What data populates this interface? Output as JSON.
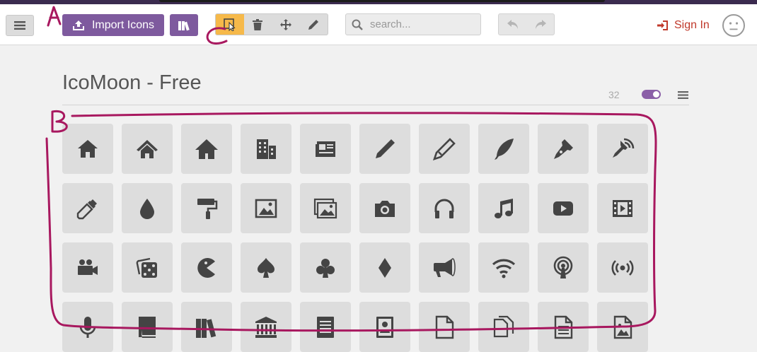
{
  "toolbar": {
    "import_label": "Import Icons",
    "search_placeholder": "search...",
    "sign_in_label": "Sign In"
  },
  "tools": [
    {
      "icon": "select-cursor-icon",
      "active": true
    },
    {
      "icon": "trash-icon",
      "active": false
    },
    {
      "icon": "move-icon",
      "active": false
    },
    {
      "icon": "pencil-edit-icon",
      "active": false
    }
  ],
  "set": {
    "title": "IcoMoon - Free",
    "count": "32"
  },
  "annotations": {
    "a": "A",
    "b": "B",
    "c": "C"
  },
  "colors": {
    "accent_purple": "#7e5a9e",
    "active_tool": "#f6b94a",
    "sign_in": "#c0392b",
    "annotation": "#a8185f"
  },
  "icons": [
    "home-icon",
    "home2-icon",
    "home3-icon",
    "office-icon",
    "newspaper-icon",
    "pencil-icon",
    "pencil2-icon",
    "quill-icon",
    "pen-icon",
    "blog-icon",
    "eyedropper-icon",
    "droplet-icon",
    "paint-format-icon",
    "image-icon",
    "images-icon",
    "camera-icon",
    "headphones-icon",
    "music-icon",
    "play-icon",
    "film-icon",
    "video-camera-icon",
    "dice-icon",
    "pacman-icon",
    "spades-icon",
    "clubs-icon",
    "diamonds-icon",
    "bullhorn-icon",
    "connection-icon",
    "podcast-icon",
    "feed-icon",
    "mic-icon",
    "book-icon",
    "books-icon",
    "library-icon",
    "file-text-icon",
    "profile-icon",
    "file-empty-icon",
    "files-empty-icon",
    "file-text2-icon",
    "file-picture-icon"
  ]
}
